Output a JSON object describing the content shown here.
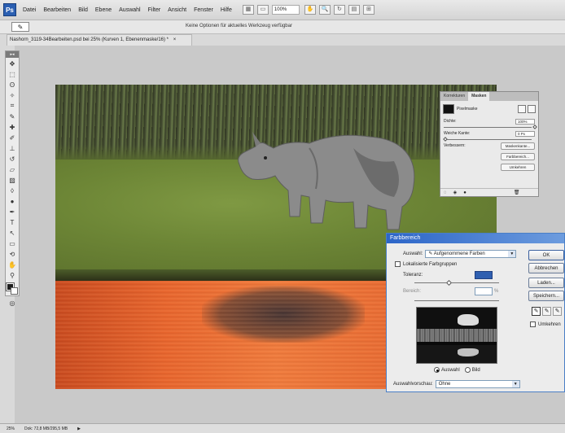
{
  "app": {
    "logo": "Ps"
  },
  "menu": [
    "Datei",
    "Bearbeiten",
    "Bild",
    "Ebene",
    "Auswahl",
    "Filter",
    "Ansicht",
    "Fenster",
    "Hilfe"
  ],
  "menubar_extras": {
    "zoom": "100%"
  },
  "options_bar": {
    "hint": "Keine Optionen für aktuelles Werkzeug verfügbar"
  },
  "document": {
    "tab_title": "Nashorn_3119-34Bearbeiten.psd bei 25% (Kurven 1, Ebenenmaske/16) *",
    "close": "×"
  },
  "toolbar": {
    "grip": "▸◂"
  },
  "masks_panel": {
    "tabs": [
      "Korrekturen",
      "Masken"
    ],
    "active_tab": "Masken",
    "mask_name": "Pixelmaske",
    "density_label": "Dichte:",
    "density_value": "100%",
    "feather_label": "Weiche Kante:",
    "feather_value": "0 Px",
    "refine_label": "Verbessern:",
    "buttons": [
      "Maskenkante...",
      "Farbbereich...",
      "Umkehren"
    ],
    "footer_icons": [
      "◌",
      "◈",
      "●",
      "🗑"
    ]
  },
  "color_range_dialog": {
    "title": "Farbbereich",
    "select_label": "Auswahl:",
    "select_value": "Aufgenommene Farben",
    "localized_label": "Lokalisierte Farbgruppen",
    "tolerance_label": "Toleranz:",
    "tolerance_value": "",
    "range_label": "Bereich:",
    "range_value": "",
    "radio_selection": "Auswahl",
    "radio_image": "Bild",
    "preview_label": "Auswahlvorschau:",
    "preview_value": "Ohne",
    "buttons": {
      "ok": "OK",
      "cancel": "Abbrechen",
      "load": "Laden...",
      "save": "Speichern..."
    },
    "invert_label": "Umkehren"
  },
  "status_bar": {
    "zoom": "25%",
    "doc_info": "Dok: 72,8 MB/295,5 MB"
  }
}
